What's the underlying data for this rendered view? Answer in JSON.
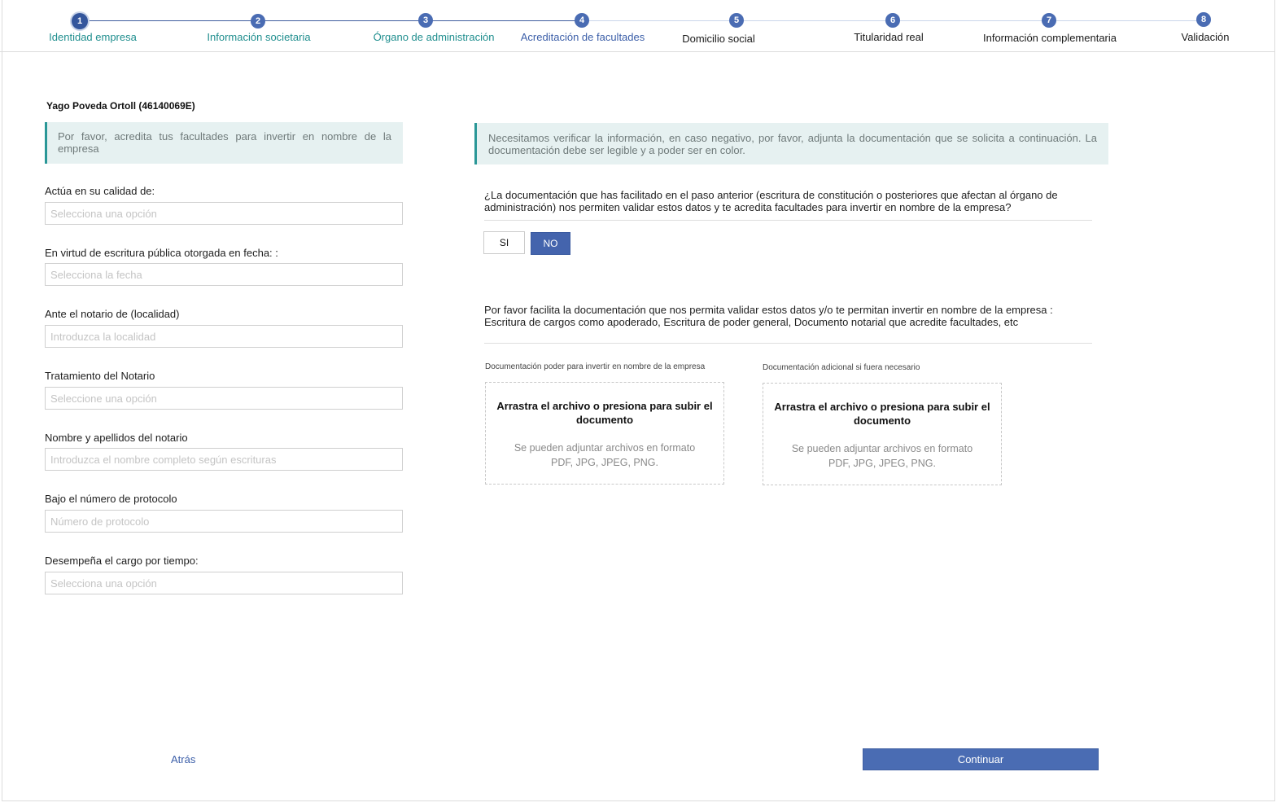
{
  "stepper": {
    "steps": [
      {
        "number": "1",
        "label": "Identidad empresa"
      },
      {
        "number": "2",
        "label": "Información societaria"
      },
      {
        "number": "3",
        "label": "Órgano de administración"
      },
      {
        "number": "4",
        "label": "Acreditación de facultades"
      },
      {
        "number": "5",
        "label": "Domicilio social"
      },
      {
        "number": "6",
        "label": "Titularidad real"
      },
      {
        "number": "7",
        "label": "Información complementaria"
      },
      {
        "number": "8",
        "label": "Validación"
      }
    ],
    "current_step": 4
  },
  "left": {
    "user_name": "Yago Poveda Ortoll (46140069E)",
    "info": "Por favor, acredita tus facultades para invertir en nombre de la empresa",
    "fields": [
      {
        "label": "Actúa en su calidad de:",
        "placeholder": "Selecciona una opción",
        "value": ""
      },
      {
        "label": "En virtud de escritura pública otorgada en fecha: :",
        "placeholder": "Selecciona la fecha",
        "value": ""
      },
      {
        "label": "Ante el notario de (localidad)",
        "placeholder": "Introduzca la localidad",
        "value": ""
      },
      {
        "label": "Tratamiento del Notario",
        "placeholder": "Seleccione una opción",
        "value": ""
      },
      {
        "label": "Nombre y apellidos del notario",
        "placeholder": "Introduzca el nombre completo según escrituras",
        "value": ""
      },
      {
        "label": "Bajo el número de protocolo",
        "placeholder": "Número de protocolo",
        "value": ""
      },
      {
        "label": "Desempeña el cargo por tiempo:",
        "placeholder": "Selecciona una opción",
        "value": ""
      }
    ]
  },
  "right": {
    "info": "Necesitamos verificar la información, en caso negativo, por favor, adjunta la documentación que se solicita a continuación. La documentación debe ser legible y a poder ser en color.",
    "question": "¿La documentación que has facilitado en el paso anterior (escritura de constitución o posteriores que afectan al órgano de administración) nos permiten validar estos datos y te acredita facultades para invertir en nombre de la empresa?",
    "yes_label": "SI",
    "no_label": "NO",
    "selected": "NO",
    "doc_request": "Por favor facilita la documentación que nos permita validar estos datos y/o te permitan invertir en nombre de la empresa : Escritura de cargos como apoderado, Escritura de poder general, Documento notarial que acredite facultades, etc",
    "uploads": [
      {
        "title": "Documentación  poder para invertir en nombre de la empresa",
        "main": "Arrastra el archivo o presiona para subir el documento",
        "sub": "Se pueden adjuntar archivos en formato PDF, JPG, JPEG, PNG."
      },
      {
        "title": "Documentación  adicional  si fuera necesario",
        "main": "Arrastra el archivo o presiona para subir el documento",
        "sub": "Se pueden adjuntar archivos en formato PDF, JPG, JPEG, PNG."
      }
    ]
  },
  "footer": {
    "back_label": "Atrás",
    "continue_label": "Continuar"
  },
  "colors": {
    "primary": "#4a6cb3",
    "teal_text": "#1f8e8e",
    "info_bg": "#e6f1f1",
    "info_border": "#2a9797"
  }
}
